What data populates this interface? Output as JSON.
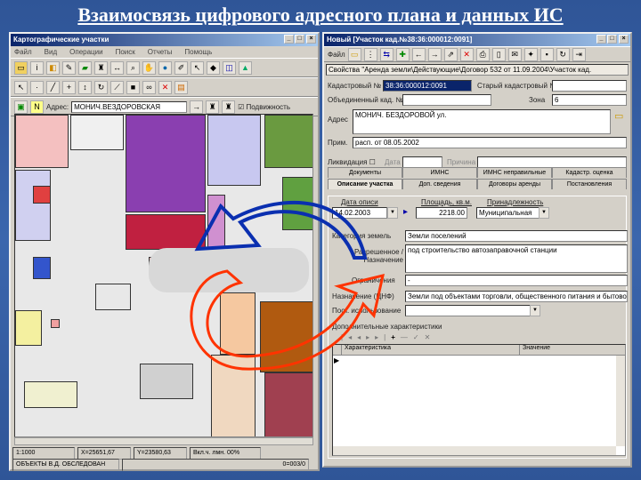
{
  "slide_title": "Взаимосвязь цифрового адресного плана и данных ИС",
  "map_window": {
    "title": "Картографические участки",
    "menu": [
      "Файл",
      "Вид",
      "Операции",
      "Поиск",
      "Отчеты",
      "Помощь"
    ],
    "search_label": "Адрес:",
    "search_value": "МОНИЧ.ВЕЗДОРОВСКАЯ",
    "checkbox_label": "Подвижность",
    "checkbox_checked": true,
    "status": {
      "scale": "1:1000",
      "x": "X=25651,67",
      "y": "Y=23580,63",
      "zoom": "Вкл.ч. лмн. 00%",
      "layer": "ОБЪЕКТЫ В.Д. ОБСЛЕДОВАН",
      "count": "0=003/0"
    }
  },
  "form_window": {
    "title": "Новый [Участок кад.№38:36:000012:0091]",
    "menu_label": "Файл",
    "path": "Свойства \"Аренда земли\\Действующие\\Договор 532 от 11.09.2004\\Участок кад.",
    "fields": {
      "cadastral_label": "Кадастровый №",
      "cadastral_value": "38:36:000012:0091",
      "old_label": "Старый кадастровый №",
      "old_value": "",
      "merged_label": "Объединенный кад. №",
      "merged_value": "",
      "zone_label": "Зона",
      "zone_value": "6",
      "address_label": "Адрес",
      "address_value": "МОНИЧ. БЕЗДОРОВОЙ ул.",
      "note_label": "Прим.",
      "note_value": "расп. от 08.05.2002",
      "liquidation_label": "Ликвидация",
      "date_label": "Дата",
      "reason_label": "Причина"
    },
    "tabs_row1": [
      "Документы",
      "ИМНС",
      "ИМНС неправильные",
      "Кадастр. оценка"
    ],
    "tabs_row2": [
      "Описание участка",
      "Доп. сведения",
      "Договоры аренды",
      "Постановления"
    ],
    "description": {
      "date_label": "Дата описи",
      "date_value": "14.02.2003",
      "area_label": "Площадь, кв.м.",
      "area_value": "2218.00",
      "owner_label": "Принадлежность",
      "owner_value": "Муниципальная",
      "category_label": "Категория земель",
      "category_value": "Земли поселений",
      "use_label": "Разрешенное / Назначение",
      "use_value": "под строительство автозаправочной станции",
      "limits_label": "Ограничения",
      "limits_value": "-",
      "purpose_label": "Назначение (ЦНФ)",
      "purpose_value": "Земли под объектами торговли, общественного питания и бытового обслуживания",
      "post_label": "Пост. использование",
      "post_value": "",
      "chars_label": "Дополнительные характеристики",
      "col1": "Характеристика",
      "col2": "Значение"
    }
  }
}
